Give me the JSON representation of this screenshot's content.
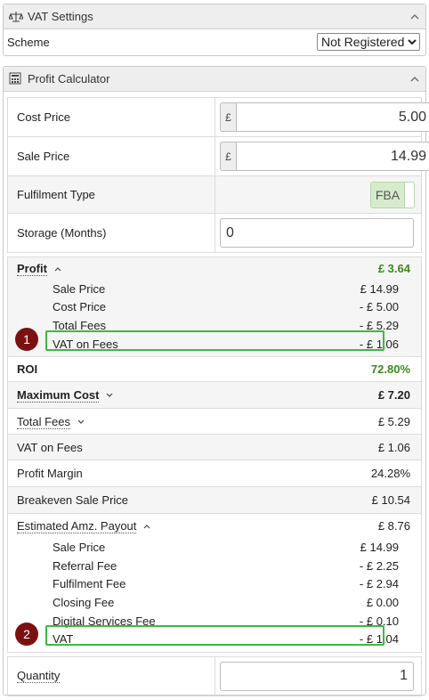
{
  "vat_settings": {
    "title": "VAT Settings",
    "scheme_label": "Scheme",
    "scheme_value": "Not Registered"
  },
  "calculator": {
    "title": "Profit Calculator",
    "currency": "£",
    "cost_price": {
      "label": "Cost Price",
      "value": "5.00"
    },
    "sale_price": {
      "label": "Sale Price",
      "value": "14.99"
    },
    "fulfilment": {
      "label": "Fulfilment Type",
      "value": "FBA"
    },
    "storage": {
      "label": "Storage (Months)",
      "value": "0"
    },
    "profit": {
      "label": "Profit",
      "value": "£ 3.64",
      "items": [
        {
          "label": "Sale Price",
          "value": "£ 14.99"
        },
        {
          "label": "Cost Price",
          "value": "- £ 5.00"
        },
        {
          "label": "Total Fees",
          "value": "- £ 5.29"
        },
        {
          "label": "VAT on Fees",
          "value": "- £ 1.06"
        }
      ]
    },
    "roi": {
      "label": "ROI",
      "value": "72.80%"
    },
    "max_cost": {
      "label": "Maximum Cost",
      "value": "£ 7.20"
    },
    "total_fees": {
      "label": "Total Fees",
      "value": "£ 5.29"
    },
    "vat_on_fees": {
      "label": "VAT on Fees",
      "value": "£ 1.06"
    },
    "profit_margin": {
      "label": "Profit Margin",
      "value": "24.28%"
    },
    "breakeven": {
      "label": "Breakeven Sale Price",
      "value": "£ 10.54"
    },
    "payout": {
      "label": "Estimated Amz. Payout",
      "value": "£ 8.76",
      "items": [
        {
          "label": "Sale Price",
          "value": "£ 14.99"
        },
        {
          "label": "Referral Fee",
          "value": "- £ 2.25"
        },
        {
          "label": "Fulfilment Fee",
          "value": "- £ 2.94"
        },
        {
          "label": "Closing Fee",
          "value": "£ 0.00"
        },
        {
          "label": "Digital Services Fee",
          "value": "- £ 0.10"
        },
        {
          "label": "VAT",
          "value": "- £ 1.04"
        }
      ]
    },
    "quantity": {
      "label": "Quantity",
      "value": "1"
    }
  },
  "annotations": {
    "badge1": "1",
    "badge2": "2"
  },
  "colors": {
    "accent_green": "#3a8a1a",
    "highlight": "#3dba3d",
    "badge": "#7a1111"
  }
}
